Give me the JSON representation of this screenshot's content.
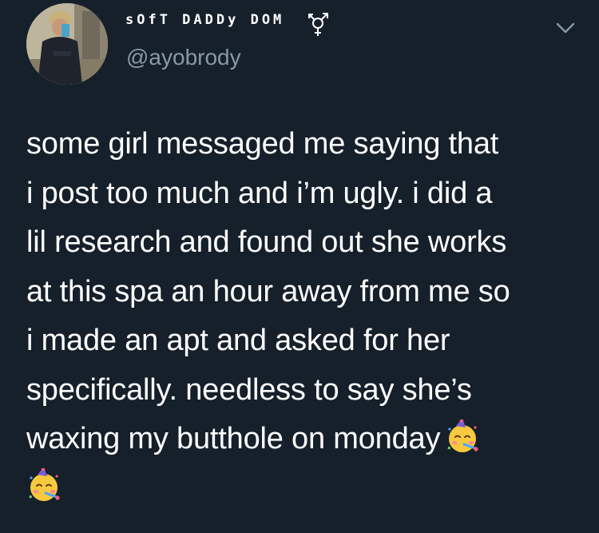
{
  "user": {
    "display_name": "sOfT DADDy DOM",
    "handle": "@ayobrody"
  },
  "icons": {
    "avatar": "profile-photo",
    "gender": "transgender-symbol-icon",
    "more": "chevron-down-icon",
    "emoji": "partying-face-emoji"
  },
  "tweet": {
    "lines": [
      "some girl messaged me saying that",
      "i post too much and i’m ugly. i did a",
      "lil research and found out she works",
      "at this spa an hour away from me so",
      "i made an apt and asked for her",
      "specifically. needless to say she’s",
      "waxing my butthole on monday"
    ]
  },
  "colors": {
    "background": "#15202b",
    "text": "#ffffff",
    "secondary_text": "#8899a6"
  }
}
